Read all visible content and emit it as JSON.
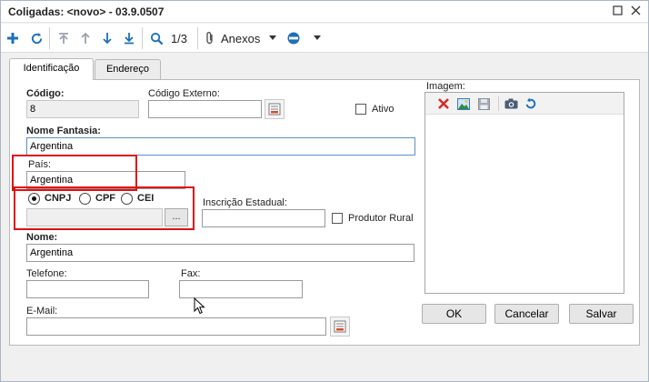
{
  "window": {
    "title": "Coligadas: <novo> - 03.9.0507"
  },
  "toolbar": {
    "record_counter": "1/3",
    "anexos_label": "Anexos"
  },
  "tabs": [
    {
      "label": "Identificação",
      "active": true
    },
    {
      "label": "Endereço",
      "active": false
    }
  ],
  "form": {
    "codigo_label": "Código:",
    "codigo_value": "8",
    "codigo_externo_label": "Código Externo:",
    "codigo_externo_value": "",
    "ativo_label": "Ativo",
    "nome_fantasia_label": "Nome Fantasia:",
    "nome_fantasia_value": "Argentina",
    "pais_label": "País:",
    "pais_value": "Argentina",
    "doc_type_options": [
      "CNPJ",
      "CPF",
      "CEI"
    ],
    "doc_type_selected": "CNPJ",
    "doc_number_value": "",
    "browse_label": "...",
    "inscricao_label": "Inscrição Estadual:",
    "inscricao_value": "",
    "produtor_rural_label": "Produtor Rural",
    "nome_label": "Nome:",
    "nome_value": "Argentina",
    "telefone_label": "Telefone:",
    "telefone_value": "",
    "fax_label": "Fax:",
    "fax_value": "",
    "email_label": "E-Mail:",
    "email_value": ""
  },
  "image_panel": {
    "label": "Imagem:"
  },
  "footer": {
    "ok_label": "OK",
    "cancel_label": "Cancelar",
    "save_label": "Salvar"
  },
  "colors": {
    "highlight": "#e01010",
    "accent_blue": "#1f6fb8",
    "delete_red": "#d62a2a"
  }
}
